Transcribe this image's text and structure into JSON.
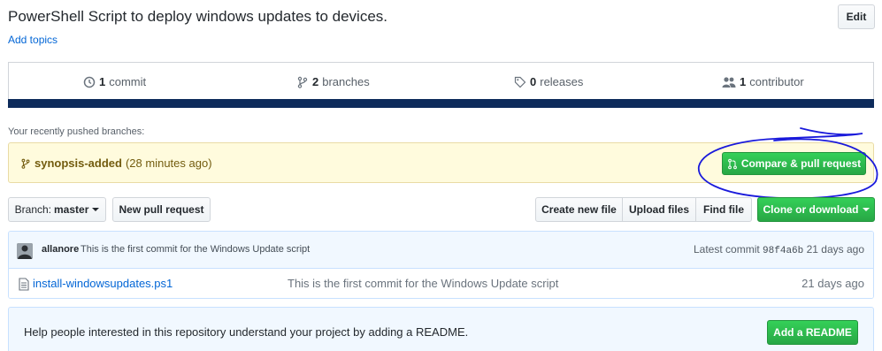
{
  "repo": {
    "description": "PowerShell Script to deploy windows updates to devices.",
    "edit_label": "Edit",
    "add_topics_label": "Add topics"
  },
  "summary": {
    "commits_count": "1",
    "commits_label": "commit",
    "branches_count": "2",
    "branches_label": "branches",
    "releases_count": "0",
    "releases_label": "releases",
    "contributors_count": "1",
    "contributors_label": "contributor"
  },
  "pushed": {
    "label": "Your recently pushed branches:",
    "branch_name": "synopsis-added",
    "time": "(28 minutes ago)",
    "compare_label": "Compare & pull request"
  },
  "toolbar": {
    "branch_prefix": "Branch:",
    "branch_name": "master",
    "new_pr_label": "New pull request",
    "create_file_label": "Create new file",
    "upload_files_label": "Upload files",
    "find_file_label": "Find file",
    "clone_label": "Clone or download"
  },
  "latest_commit": {
    "author": "allanore",
    "message": "This is the first commit for the Windows Update script",
    "prefix": "Latest commit",
    "sha": "98f4a6b",
    "age": "21 days ago"
  },
  "files": [
    {
      "name": "install-windowsupdates.ps1",
      "message": "This is the first commit for the Windows Update script",
      "age": "21 days ago"
    }
  ],
  "readme": {
    "text": "Help people interested in this repository understand your project by adding a README.",
    "button_label": "Add a README"
  },
  "colors": {
    "link": "#0366d6",
    "primary_green": "#28a745",
    "summary_bar": "#0d2b5b",
    "annotation_ink": "#1a1adb"
  }
}
